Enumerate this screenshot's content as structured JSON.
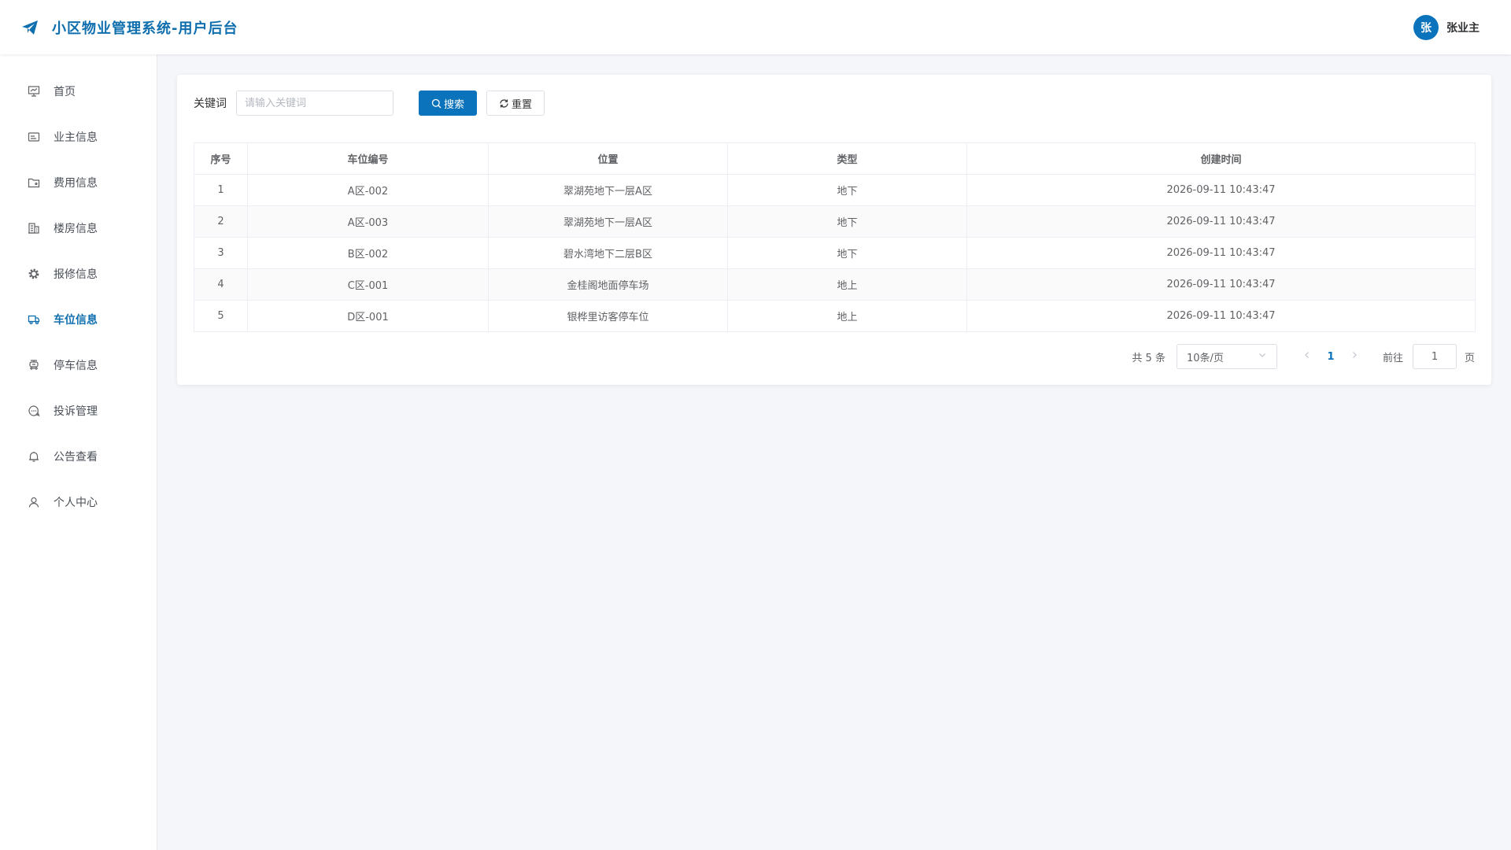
{
  "colors": {
    "brand": "#0f6fae",
    "primary": "#0b73bb",
    "background": "#f5f6fa"
  },
  "header": {
    "title": "小区物业管理系统-用户后台",
    "logo_icon": "paper-plane-icon",
    "user": {
      "avatar_text": "张",
      "name": "张业主"
    }
  },
  "sidebar": {
    "items": [
      {
        "label": "首页",
        "icon": "presentation-icon",
        "active": false
      },
      {
        "label": "业主信息",
        "icon": "id-card-icon",
        "active": false
      },
      {
        "label": "费用信息",
        "icon": "folder-icon",
        "active": false
      },
      {
        "label": "楼房信息",
        "icon": "building-icon",
        "active": false
      },
      {
        "label": "报修信息",
        "icon": "gear-icon",
        "active": false
      },
      {
        "label": "车位信息",
        "icon": "truck-icon",
        "active": true
      },
      {
        "label": "停车信息",
        "icon": "parking-icon",
        "active": false
      },
      {
        "label": "投诉管理",
        "icon": "chat-icon",
        "active": false
      },
      {
        "label": "公告查看",
        "icon": "bell-icon",
        "active": false
      },
      {
        "label": "个人中心",
        "icon": "user-icon",
        "active": false
      }
    ]
  },
  "filter": {
    "keyword_label": "关键词",
    "keyword_placeholder": "请输入关键词",
    "keyword_value": "",
    "search_label": "搜索",
    "reset_label": "重置"
  },
  "table": {
    "columns": [
      "序号",
      "车位编号",
      "位置",
      "类型",
      "创建时间"
    ],
    "rows": [
      [
        "1",
        "A区-002",
        "翠湖苑地下一层A区",
        "地下",
        "2026-09-11 10:43:47"
      ],
      [
        "2",
        "A区-003",
        "翠湖苑地下一层A区",
        "地下",
        "2026-09-11 10:43:47"
      ],
      [
        "3",
        "B区-002",
        "碧水湾地下二层B区",
        "地下",
        "2026-09-11 10:43:47"
      ],
      [
        "4",
        "C区-001",
        "金桂阁地面停车场",
        "地上",
        "2026-09-11 10:43:47"
      ],
      [
        "5",
        "D区-001",
        "银桦里访客停车位",
        "地上",
        "2026-09-11 10:43:47"
      ]
    ]
  },
  "pagination": {
    "total_text": "共 5 条",
    "page_size": "10条/页",
    "current_page": "1",
    "goto_label": "前往",
    "goto_value": "1",
    "page_suffix": "页"
  }
}
